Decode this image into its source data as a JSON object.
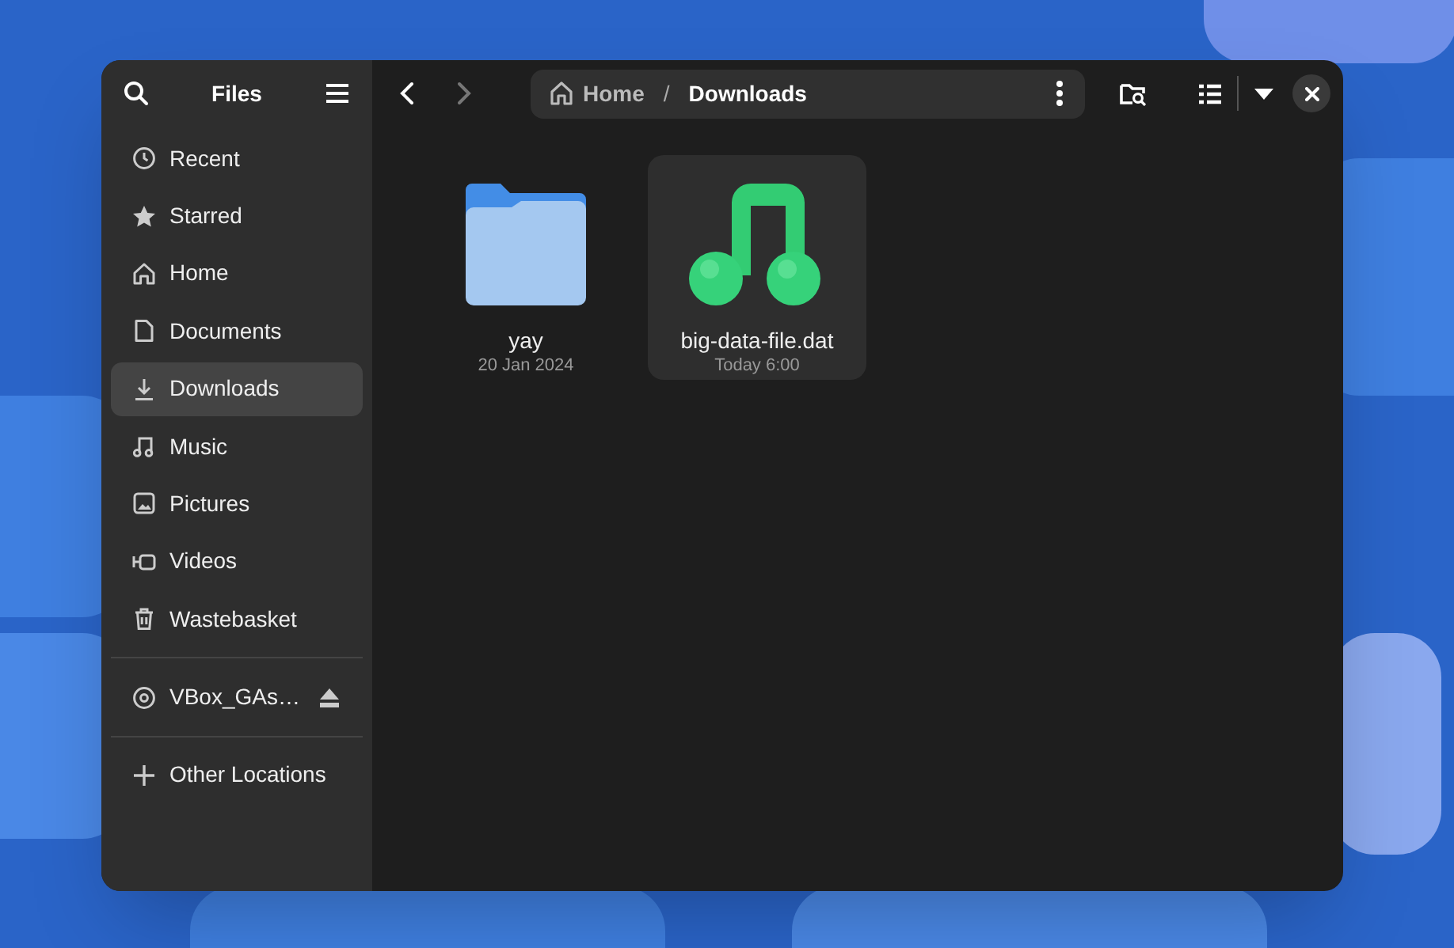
{
  "window": {
    "title": "Files"
  },
  "sidebar": {
    "places": [
      {
        "label": "Recent",
        "selected": false
      },
      {
        "label": "Starred",
        "selected": false
      },
      {
        "label": "Home",
        "selected": false
      },
      {
        "label": "Documents",
        "selected": false
      },
      {
        "label": "Downloads",
        "selected": true
      },
      {
        "label": "Music",
        "selected": false
      },
      {
        "label": "Pictures",
        "selected": false
      },
      {
        "label": "Videos",
        "selected": false
      },
      {
        "label": "Wastebasket",
        "selected": false
      }
    ],
    "devices": [
      {
        "label": "VBox_GAs…",
        "selected": false
      }
    ],
    "other": [
      {
        "label": "Other Locations",
        "selected": false
      }
    ]
  },
  "path_bar": {
    "segments": [
      {
        "label": "Home",
        "selected": false
      },
      {
        "label": "Downloads",
        "selected": true
      }
    ],
    "separator": "/"
  },
  "files": [
    {
      "kind": "folder",
      "name": "yay",
      "date": "20 Jan 2024",
      "selected": false
    },
    {
      "kind": "audio",
      "name": "big-data-file.dat",
      "date": "Today 6:00",
      "selected": true
    }
  ]
}
